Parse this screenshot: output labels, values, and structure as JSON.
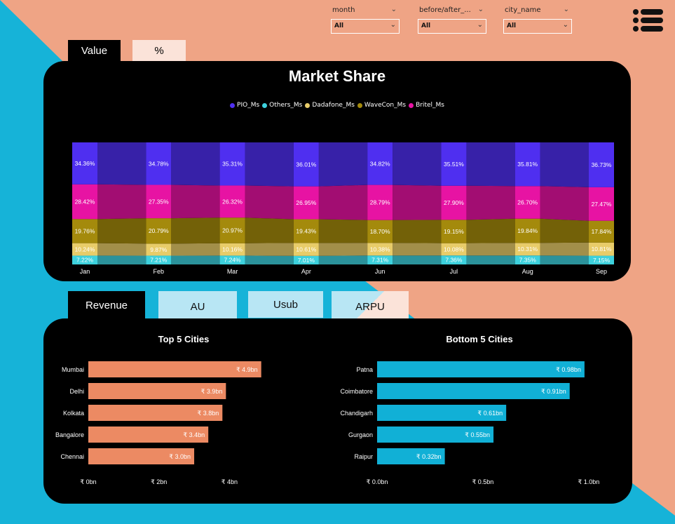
{
  "filters": [
    {
      "label": "month",
      "value": "All"
    },
    {
      "label": "before/after_...",
      "value": "All"
    },
    {
      "label": "city_name",
      "value": "All"
    }
  ],
  "icons": {
    "menu": "hamburger-menu-icon",
    "dropdown": "chevron-down-icon"
  },
  "top_tabs": {
    "value": "Value",
    "percent": "%"
  },
  "bottom_tabs": {
    "revenue": "Revenue",
    "au": "AU",
    "usub": "Usub",
    "arpu": "ARPU"
  },
  "market_share": {
    "title": "Market Share"
  },
  "colors": {
    "background": "#efa485",
    "blue_shape": "#16b3d8",
    "panel": "#000000",
    "top_bar": "#ec8a63",
    "bottom_bar": "#11b0d6"
  },
  "chart_data": [
    {
      "type": "area",
      "title": "Market Share",
      "stacked": true,
      "normalized_percent": true,
      "legend_position": "top-center",
      "categories": [
        "Jan",
        "Feb",
        "Mar",
        "Apr",
        "Jun",
        "Jul",
        "Aug",
        "Sep"
      ],
      "series": [
        {
          "name": "PIO_Ms",
          "color": "#4f2ff0",
          "values": [
            34.36,
            34.78,
            35.31,
            36.01,
            34.82,
            35.51,
            35.81,
            36.73
          ],
          "labels": [
            "34.36%",
            "34.78%",
            "35.31%",
            "36.01%",
            "34.82%",
            "35.51%",
            "35.81%",
            "36.73%"
          ]
        },
        {
          "name": "Others_Ms",
          "color": "#3dd1dd",
          "values": [
            7.22,
            7.21,
            7.24,
            7.01,
            7.31,
            7.36,
            7.35,
            7.15
          ],
          "labels": [
            "7.22%",
            "7.21%",
            "7.24%",
            "7.01%",
            "7.31%",
            "7.36%",
            "7.35%",
            "7.15%"
          ]
        },
        {
          "name": "Dadafone_Ms",
          "color": "#e8cc69",
          "values": [
            10.24,
            9.87,
            10.16,
            10.61,
            10.38,
            10.08,
            10.31,
            10.81
          ],
          "labels": [
            "10.24%",
            "9.87%",
            "10.16%",
            "10.61%",
            "10.38%",
            "10.08%",
            "10.31%",
            "10.81%"
          ]
        },
        {
          "name": "WaveCon_Ms",
          "color": "#a48a0c",
          "values": [
            19.76,
            20.79,
            20.97,
            19.43,
            18.7,
            19.15,
            19.84,
            17.84
          ],
          "labels": [
            "19.76%",
            "20.79%",
            "20.97%",
            "19.43%",
            "18.70%",
            "19.15%",
            "19.84%",
            "17.84%"
          ]
        },
        {
          "name": "Britel_Ms",
          "color": "#e713a3",
          "values": [
            28.42,
            27.35,
            26.32,
            26.95,
            28.79,
            27.9,
            26.7,
            27.47
          ],
          "labels": [
            "28.42%",
            "27.35%",
            "26.32%",
            "26.95%",
            "28.79%",
            "27.90%",
            "26.70%",
            "27.47%"
          ]
        }
      ]
    },
    {
      "type": "bar",
      "orientation": "horizontal",
      "title": "Top 5 Cities",
      "categories": [
        "Mumbai",
        "Delhi",
        "Kolkata",
        "Bangalore",
        "Chennai"
      ],
      "values": [
        4.9,
        3.9,
        3.8,
        3.4,
        3.0
      ],
      "data_labels": [
        "₹ 4.9bn",
        "₹ 3.9bn",
        "₹ 3.8bn",
        "₹ 3.4bn",
        "₹ 3.0bn"
      ],
      "x_ticks": [
        0,
        2,
        4
      ],
      "x_tick_labels": [
        "₹ 0bn",
        "₹ 2bn",
        "₹ 4bn"
      ],
      "xlim": [
        0,
        5.8
      ],
      "color": "#ec8a63"
    },
    {
      "type": "bar",
      "orientation": "horizontal",
      "title": "Bottom 5 Cities",
      "categories": [
        "Patna",
        "Coimbatore",
        "Chandigarh",
        "Gurgaon",
        "Raipur"
      ],
      "values": [
        0.98,
        0.91,
        0.61,
        0.55,
        0.32
      ],
      "data_labels": [
        "₹ 0.98bn",
        "₹ 0.91bn",
        "₹ 0.61bn",
        "₹ 0.55bn",
        "₹ 0.32bn"
      ],
      "x_ticks": [
        0,
        0.5,
        1.0
      ],
      "x_tick_labels": [
        "₹ 0.0bn",
        "₹ 0.5bn",
        "₹ 1.0bn"
      ],
      "xlim": [
        0,
        1.05
      ],
      "color": "#11b0d6"
    }
  ]
}
